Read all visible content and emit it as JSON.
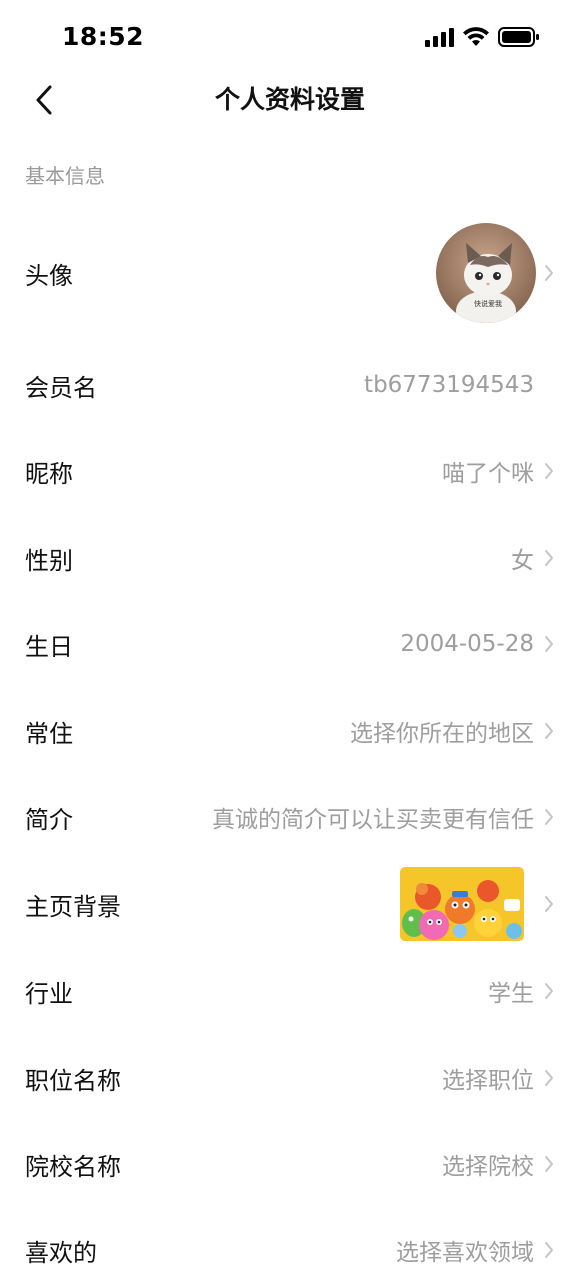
{
  "status_bar": {
    "time": "18:52"
  },
  "nav": {
    "title": "个人资料设置"
  },
  "section": {
    "title": "基本信息"
  },
  "rows": [
    {
      "label": "头像",
      "value": ""
    },
    {
      "label": "会员名",
      "value": "tb6773194543"
    },
    {
      "label": "昵称",
      "value": "喵了个咪"
    },
    {
      "label": "性别",
      "value": "女"
    },
    {
      "label": "生日",
      "value": "2004-05-28"
    },
    {
      "label": "常住",
      "value": "选择你所在的地区"
    },
    {
      "label": "简介",
      "value": "真诚的简介可以让买卖更有信任"
    },
    {
      "label": "主页背景",
      "value": ""
    },
    {
      "label": "行业",
      "value": "学生"
    },
    {
      "label": "职位名称",
      "value": "选择职位"
    },
    {
      "label": "院校名称",
      "value": "选择院校"
    },
    {
      "label": "喜欢的",
      "value": "选择喜欢领域"
    }
  ],
  "avatar": {
    "caption": "快说爱我"
  },
  "icons": {
    "back": "back-arrow-icon",
    "chevron": "chevron-right-icon",
    "signal": "cellular-signal-icon",
    "wifi": "wifi-icon",
    "battery": "battery-icon"
  }
}
